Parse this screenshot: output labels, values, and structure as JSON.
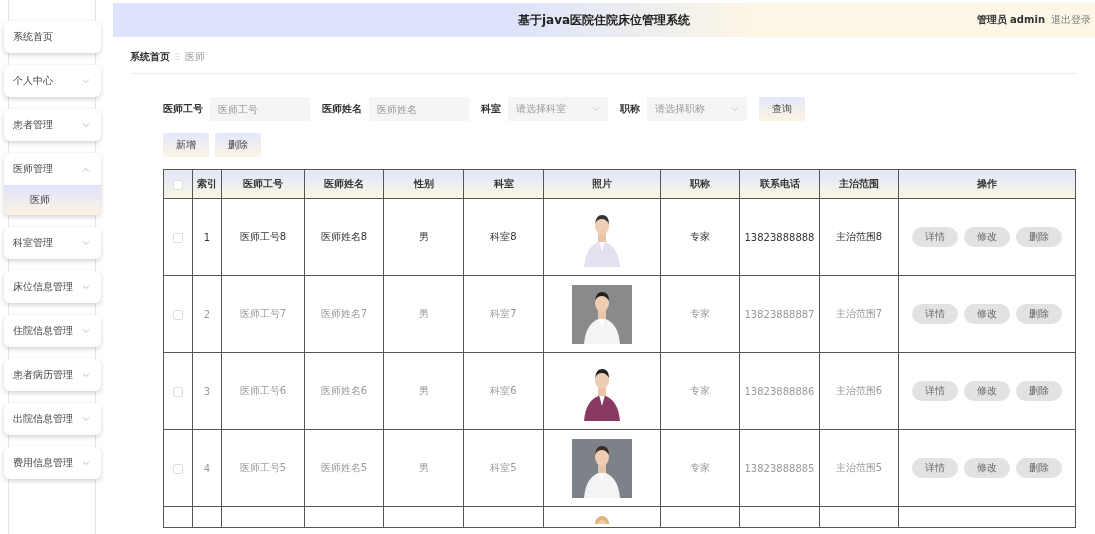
{
  "header": {
    "title": "基于java医院住院床位管理系统",
    "role": "管理员",
    "username": "admin",
    "logout": "退出登录"
  },
  "sidebar": {
    "items": [
      {
        "label": "系统首页"
      },
      {
        "label": "个人中心",
        "expanded": false
      },
      {
        "label": "患者管理",
        "expanded": false
      },
      {
        "label": "医师管理",
        "expanded": true,
        "children": [
          {
            "label": "医师",
            "selected": true
          }
        ]
      },
      {
        "label": "科室管理",
        "expanded": false
      },
      {
        "label": "床位信息管理",
        "expanded": false
      },
      {
        "label": "住院信息管理",
        "expanded": false
      },
      {
        "label": "患者病历管理",
        "expanded": false
      },
      {
        "label": "出院信息管理",
        "expanded": false
      },
      {
        "label": "费用信息管理",
        "expanded": false
      }
    ]
  },
  "breadcrumb": [
    {
      "label": "系统首页",
      "current": false
    },
    {
      "label": "医师",
      "current": true
    }
  ],
  "filters": [
    {
      "kind": "text",
      "label": "医师工号",
      "placeholder": "医师工号"
    },
    {
      "kind": "text",
      "label": "医师姓名",
      "placeholder": "医师姓名"
    },
    {
      "kind": "select",
      "label": "科室",
      "placeholder": "请选择科室"
    },
    {
      "kind": "select",
      "label": "职称",
      "placeholder": "请选择职称"
    }
  ],
  "search_button": "查询",
  "actions": [
    "新增",
    "删除"
  ],
  "table": {
    "header_checked": false,
    "columns": [
      "索引",
      "医师工号",
      "医师姓名",
      "性别",
      "科室",
      "照片",
      "职称",
      "联系电话",
      "主治范围",
      "操作"
    ],
    "rows": [
      {
        "checked": false,
        "hovered": true,
        "index": "1",
        "id": "医师工号8",
        "name": "医师姓名8",
        "gender": "男",
        "dept": "科室8",
        "title": "专家",
        "phone": "13823888888",
        "scope": "主治范围8",
        "actions": [
          "详情",
          "修改",
          "删除"
        ]
      },
      {
        "checked": false,
        "hovered": false,
        "index": "2",
        "id": "医师工号7",
        "name": "医师姓名7",
        "gender": "男",
        "dept": "科室7",
        "title": "专家",
        "phone": "13823888887",
        "scope": "主治范围7",
        "actions": [
          "详情",
          "修改",
          "删除"
        ]
      },
      {
        "checked": false,
        "hovered": false,
        "index": "3",
        "id": "医师工号6",
        "name": "医师姓名6",
        "gender": "男",
        "dept": "科室6",
        "title": "专家",
        "phone": "13823888886",
        "scope": "主治范围6",
        "actions": [
          "详情",
          "修改",
          "删除"
        ]
      },
      {
        "checked": false,
        "hovered": false,
        "index": "4",
        "id": "医师工号5",
        "name": "医师姓名5",
        "gender": "男",
        "dept": "科室5",
        "title": "专家",
        "phone": "13823888885",
        "scope": "主治范围5",
        "actions": [
          "详情",
          "修改",
          "删除"
        ]
      }
    ]
  }
}
